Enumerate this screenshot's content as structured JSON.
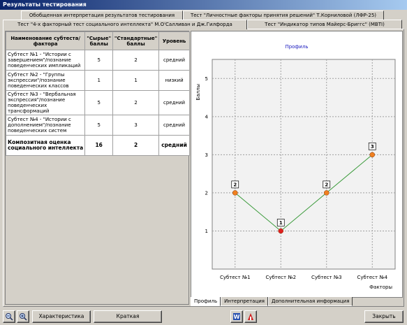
{
  "window": {
    "title": "Результаты тестирования"
  },
  "tabs_row1": [
    {
      "label": "Обобщенная интерпретация результатов тестирования"
    },
    {
      "label": "Тест \"Личностные факторы принятия решений\" Т.Корниловой (ЛФР-25)"
    }
  ],
  "tabs_row2": [
    {
      "label": "Тест \"4-х факторный тест социального интеллекта\" М.О'Салливан и Дж.Гилфорда",
      "active": true
    },
    {
      "label": "Тест \"Индикатор типов Майерс-Бриггс\" (MBTI)"
    }
  ],
  "table": {
    "headers": [
      "Наименование субтеста/фактора",
      "\"Сырые\" баллы",
      "\"Стандартные\" баллы",
      "Уровень"
    ],
    "rows": [
      {
        "name": "Субтест №1 - \"Истории с завершением\"/познание поведенческих импликаций",
        "raw": "5",
        "std": "2",
        "level": "средний",
        "bold": false
      },
      {
        "name": "Субтест №2 - \"Группы экспрессии\"/познание поведенческих классов",
        "raw": "1",
        "std": "1",
        "level": "низкий",
        "bold": false
      },
      {
        "name": "Субтест №3 - \"Вербальная экспрессия\"/познание поведенческих трансформаций",
        "raw": "5",
        "std": "2",
        "level": "средний",
        "bold": false
      },
      {
        "name": "Субтест №4 - \"Истории с дополнением\"/познание поведенческих систем",
        "raw": "5",
        "std": "3",
        "level": "средний",
        "bold": false
      },
      {
        "name": "Композитная оценка социального интеллекта",
        "raw": "16",
        "std": "2",
        "level": "средний",
        "bold": true
      }
    ]
  },
  "chart_data": {
    "type": "line",
    "title": "Профиль",
    "ylabel": "Баллы",
    "xlabel": "Факторы",
    "categories": [
      "Субтест №1",
      "Субтест №2",
      "Субтест №3",
      "Субтест №4"
    ],
    "values": [
      2,
      1,
      2,
      3
    ],
    "point_labels": [
      "2",
      "1",
      "2",
      "3"
    ],
    "yticks": [
      "1",
      "2",
      "3",
      "4",
      "5"
    ],
    "ylim": [
      0,
      5.5
    ],
    "grid": true,
    "line_color": "#3a9a3a",
    "point_color": "#f08020",
    "low_point_color": "#e02020"
  },
  "bottom_tabs": [
    {
      "label": "Профиль",
      "active": true
    },
    {
      "label": "Интерпретация"
    },
    {
      "label": "Дополнительная информация"
    }
  ],
  "buttons": {
    "characteristic": "Характеристика",
    "short_characteristic": "Краткая характеристика",
    "close": "Закрыть"
  },
  "icons": [
    "zoom-out-icon",
    "zoom-in-icon",
    "word-export-icon",
    "pdf-export-icon"
  ]
}
